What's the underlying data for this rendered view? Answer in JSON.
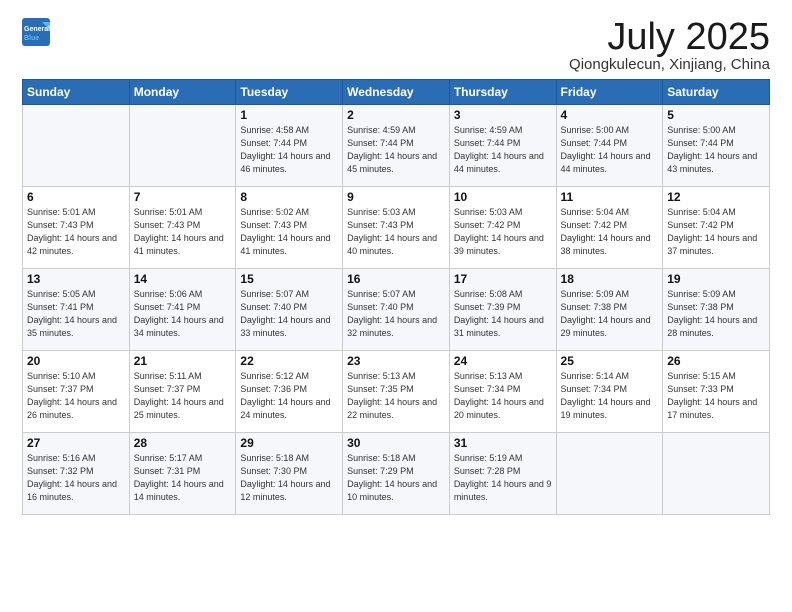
{
  "logo": {
    "line1": "General",
    "line2": "Blue"
  },
  "title": "July 2025",
  "location": "Qiongkulecun, Xinjiang, China",
  "weekdays": [
    "Sunday",
    "Monday",
    "Tuesday",
    "Wednesday",
    "Thursday",
    "Friday",
    "Saturday"
  ],
  "weeks": [
    [
      {
        "day": "",
        "sunrise": "",
        "sunset": "",
        "daylight": ""
      },
      {
        "day": "",
        "sunrise": "",
        "sunset": "",
        "daylight": ""
      },
      {
        "day": "1",
        "sunrise": "Sunrise: 4:58 AM",
        "sunset": "Sunset: 7:44 PM",
        "daylight": "Daylight: 14 hours and 46 minutes."
      },
      {
        "day": "2",
        "sunrise": "Sunrise: 4:59 AM",
        "sunset": "Sunset: 7:44 PM",
        "daylight": "Daylight: 14 hours and 45 minutes."
      },
      {
        "day": "3",
        "sunrise": "Sunrise: 4:59 AM",
        "sunset": "Sunset: 7:44 PM",
        "daylight": "Daylight: 14 hours and 44 minutes."
      },
      {
        "day": "4",
        "sunrise": "Sunrise: 5:00 AM",
        "sunset": "Sunset: 7:44 PM",
        "daylight": "Daylight: 14 hours and 44 minutes."
      },
      {
        "day": "5",
        "sunrise": "Sunrise: 5:00 AM",
        "sunset": "Sunset: 7:44 PM",
        "daylight": "Daylight: 14 hours and 43 minutes."
      }
    ],
    [
      {
        "day": "6",
        "sunrise": "Sunrise: 5:01 AM",
        "sunset": "Sunset: 7:43 PM",
        "daylight": "Daylight: 14 hours and 42 minutes."
      },
      {
        "day": "7",
        "sunrise": "Sunrise: 5:01 AM",
        "sunset": "Sunset: 7:43 PM",
        "daylight": "Daylight: 14 hours and 41 minutes."
      },
      {
        "day": "8",
        "sunrise": "Sunrise: 5:02 AM",
        "sunset": "Sunset: 7:43 PM",
        "daylight": "Daylight: 14 hours and 41 minutes."
      },
      {
        "day": "9",
        "sunrise": "Sunrise: 5:03 AM",
        "sunset": "Sunset: 7:43 PM",
        "daylight": "Daylight: 14 hours and 40 minutes."
      },
      {
        "day": "10",
        "sunrise": "Sunrise: 5:03 AM",
        "sunset": "Sunset: 7:42 PM",
        "daylight": "Daylight: 14 hours and 39 minutes."
      },
      {
        "day": "11",
        "sunrise": "Sunrise: 5:04 AM",
        "sunset": "Sunset: 7:42 PM",
        "daylight": "Daylight: 14 hours and 38 minutes."
      },
      {
        "day": "12",
        "sunrise": "Sunrise: 5:04 AM",
        "sunset": "Sunset: 7:42 PM",
        "daylight": "Daylight: 14 hours and 37 minutes."
      }
    ],
    [
      {
        "day": "13",
        "sunrise": "Sunrise: 5:05 AM",
        "sunset": "Sunset: 7:41 PM",
        "daylight": "Daylight: 14 hours and 35 minutes."
      },
      {
        "day": "14",
        "sunrise": "Sunrise: 5:06 AM",
        "sunset": "Sunset: 7:41 PM",
        "daylight": "Daylight: 14 hours and 34 minutes."
      },
      {
        "day": "15",
        "sunrise": "Sunrise: 5:07 AM",
        "sunset": "Sunset: 7:40 PM",
        "daylight": "Daylight: 14 hours and 33 minutes."
      },
      {
        "day": "16",
        "sunrise": "Sunrise: 5:07 AM",
        "sunset": "Sunset: 7:40 PM",
        "daylight": "Daylight: 14 hours and 32 minutes."
      },
      {
        "day": "17",
        "sunrise": "Sunrise: 5:08 AM",
        "sunset": "Sunset: 7:39 PM",
        "daylight": "Daylight: 14 hours and 31 minutes."
      },
      {
        "day": "18",
        "sunrise": "Sunrise: 5:09 AM",
        "sunset": "Sunset: 7:38 PM",
        "daylight": "Daylight: 14 hours and 29 minutes."
      },
      {
        "day": "19",
        "sunrise": "Sunrise: 5:09 AM",
        "sunset": "Sunset: 7:38 PM",
        "daylight": "Daylight: 14 hours and 28 minutes."
      }
    ],
    [
      {
        "day": "20",
        "sunrise": "Sunrise: 5:10 AM",
        "sunset": "Sunset: 7:37 PM",
        "daylight": "Daylight: 14 hours and 26 minutes."
      },
      {
        "day": "21",
        "sunrise": "Sunrise: 5:11 AM",
        "sunset": "Sunset: 7:37 PM",
        "daylight": "Daylight: 14 hours and 25 minutes."
      },
      {
        "day": "22",
        "sunrise": "Sunrise: 5:12 AM",
        "sunset": "Sunset: 7:36 PM",
        "daylight": "Daylight: 14 hours and 24 minutes."
      },
      {
        "day": "23",
        "sunrise": "Sunrise: 5:13 AM",
        "sunset": "Sunset: 7:35 PM",
        "daylight": "Daylight: 14 hours and 22 minutes."
      },
      {
        "day": "24",
        "sunrise": "Sunrise: 5:13 AM",
        "sunset": "Sunset: 7:34 PM",
        "daylight": "Daylight: 14 hours and 20 minutes."
      },
      {
        "day": "25",
        "sunrise": "Sunrise: 5:14 AM",
        "sunset": "Sunset: 7:34 PM",
        "daylight": "Daylight: 14 hours and 19 minutes."
      },
      {
        "day": "26",
        "sunrise": "Sunrise: 5:15 AM",
        "sunset": "Sunset: 7:33 PM",
        "daylight": "Daylight: 14 hours and 17 minutes."
      }
    ],
    [
      {
        "day": "27",
        "sunrise": "Sunrise: 5:16 AM",
        "sunset": "Sunset: 7:32 PM",
        "daylight": "Daylight: 14 hours and 16 minutes."
      },
      {
        "day": "28",
        "sunrise": "Sunrise: 5:17 AM",
        "sunset": "Sunset: 7:31 PM",
        "daylight": "Daylight: 14 hours and 14 minutes."
      },
      {
        "day": "29",
        "sunrise": "Sunrise: 5:18 AM",
        "sunset": "Sunset: 7:30 PM",
        "daylight": "Daylight: 14 hours and 12 minutes."
      },
      {
        "day": "30",
        "sunrise": "Sunrise: 5:18 AM",
        "sunset": "Sunset: 7:29 PM",
        "daylight": "Daylight: 14 hours and 10 minutes."
      },
      {
        "day": "31",
        "sunrise": "Sunrise: 5:19 AM",
        "sunset": "Sunset: 7:28 PM",
        "daylight": "Daylight: 14 hours and 9 minutes."
      },
      {
        "day": "",
        "sunrise": "",
        "sunset": "",
        "daylight": ""
      },
      {
        "day": "",
        "sunrise": "",
        "sunset": "",
        "daylight": ""
      }
    ]
  ]
}
